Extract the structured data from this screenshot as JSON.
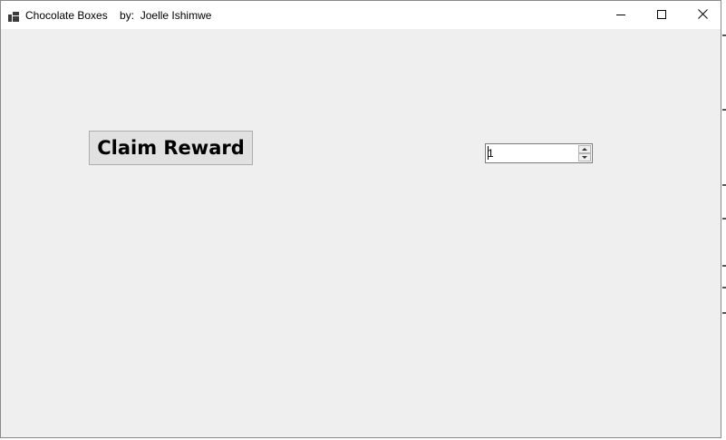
{
  "window": {
    "title": "Chocolate Boxes    by:  Joelle Ishimwe",
    "icon": "app-icon",
    "controls": {
      "minimize_icon": "minimize-icon",
      "maximize_icon": "maximize-icon",
      "close_icon": "close-icon"
    }
  },
  "main": {
    "claim_button_label": "Claim Reward",
    "quantity": {
      "value": "1",
      "up_icon": "arrow-up-icon",
      "down_icon": "arrow-down-icon"
    }
  },
  "colors": {
    "titlebar": "#ffffff",
    "client_background": "#efefef",
    "button_face": "#e1e1e1",
    "button_border": "#adadad"
  }
}
